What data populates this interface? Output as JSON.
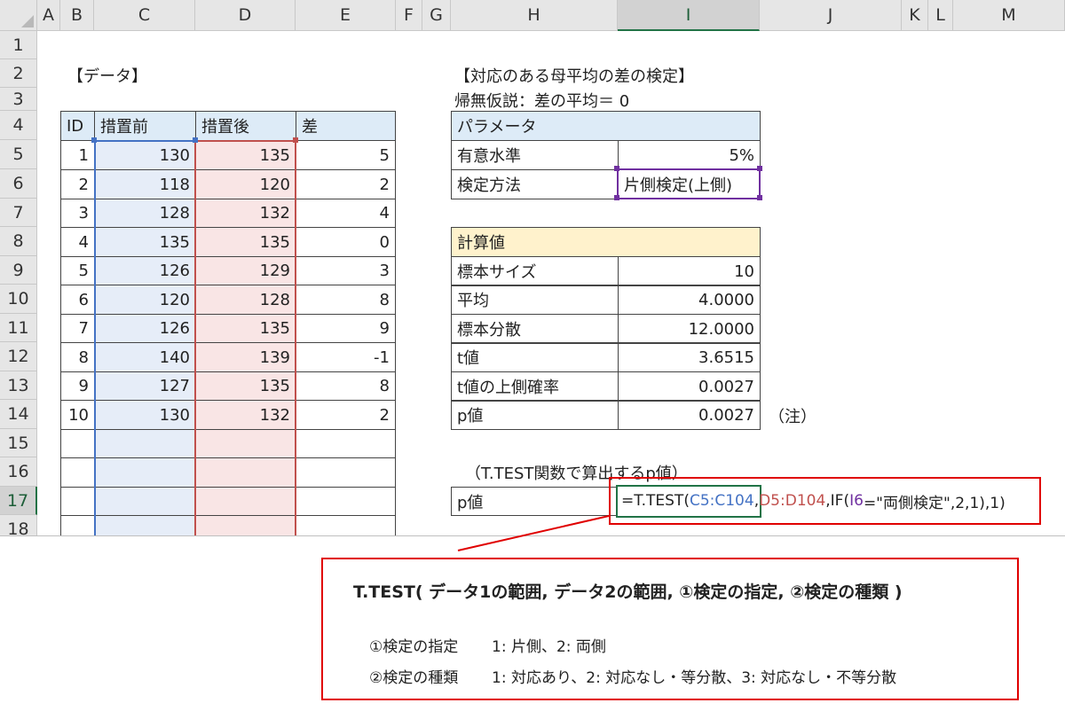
{
  "columns": [
    "A",
    "B",
    "C",
    "D",
    "E",
    "F",
    "G",
    "H",
    "I",
    "J",
    "K",
    "L",
    "M"
  ],
  "rows": [
    "1",
    "2",
    "3",
    "4",
    "5",
    "6",
    "7",
    "8",
    "9",
    "10",
    "11",
    "12",
    "13",
    "14",
    "15",
    "16",
    "17",
    "18"
  ],
  "data_title": "【データ】",
  "data_table": {
    "headers": [
      "ID",
      "措置前",
      "措置後",
      "差"
    ],
    "rows": [
      [
        "1",
        "130",
        "135",
        "5"
      ],
      [
        "2",
        "118",
        "120",
        "2"
      ],
      [
        "3",
        "128",
        "132",
        "4"
      ],
      [
        "4",
        "135",
        "135",
        "0"
      ],
      [
        "5",
        "126",
        "129",
        "3"
      ],
      [
        "6",
        "120",
        "128",
        "8"
      ],
      [
        "7",
        "126",
        "135",
        "9"
      ],
      [
        "8",
        "140",
        "139",
        "-1"
      ],
      [
        "9",
        "127",
        "135",
        "8"
      ],
      [
        "10",
        "130",
        "132",
        "2"
      ]
    ]
  },
  "test_title": "【対応のある母平均の差の検定】",
  "hypothesis": "帰無仮説：差の平均＝ 0",
  "params": {
    "header": "パラメータ",
    "rows": [
      [
        "有意水準",
        "5%"
      ],
      [
        "検定方法",
        "片側検定(上側)"
      ]
    ]
  },
  "calc": {
    "header": "計算値",
    "rows": [
      [
        "標本サイズ",
        "10"
      ],
      [
        "平均",
        "4.0000"
      ],
      [
        "標本分散",
        "12.0000"
      ],
      [
        "t値",
        "3.6515"
      ],
      [
        "t値の上側確率",
        "0.0027"
      ],
      [
        "p値",
        "0.0027"
      ]
    ]
  },
  "note": "（注）",
  "ttest_title": "（T.TEST関数で算出するp値）",
  "pvalue_label": "p値",
  "formula": {
    "p1": "=T.TEST(",
    "p2": "C5:C104",
    "p3": ",",
    "p4": "D5:D104",
    "p5": ",IF(",
    "p6": "I6",
    "p7": "=\"両側検定\",2,1),1)"
  },
  "callout": {
    "title": "T.TEST( データ1の範囲, データ2の範囲, ①検定の指定, ②検定の種類 )",
    "line1_label": "①検定の指定",
    "line1_text": "1: 片側、2: 両側",
    "line2_label": "②検定の種類",
    "line2_text": "1: 対応あり、2: 対応なし・等分散、3: 対応なし・不等分散"
  },
  "colors": {
    "blue_fill": "#e6edf8",
    "red_fill": "#f9e5e5",
    "header_blue": "#ddebf7",
    "header_yellow": "#fff2cc",
    "ref_blue": "#4472c4",
    "ref_red": "#c0504d",
    "ref_purple": "#7030a0",
    "callout_red": "#e00000"
  }
}
